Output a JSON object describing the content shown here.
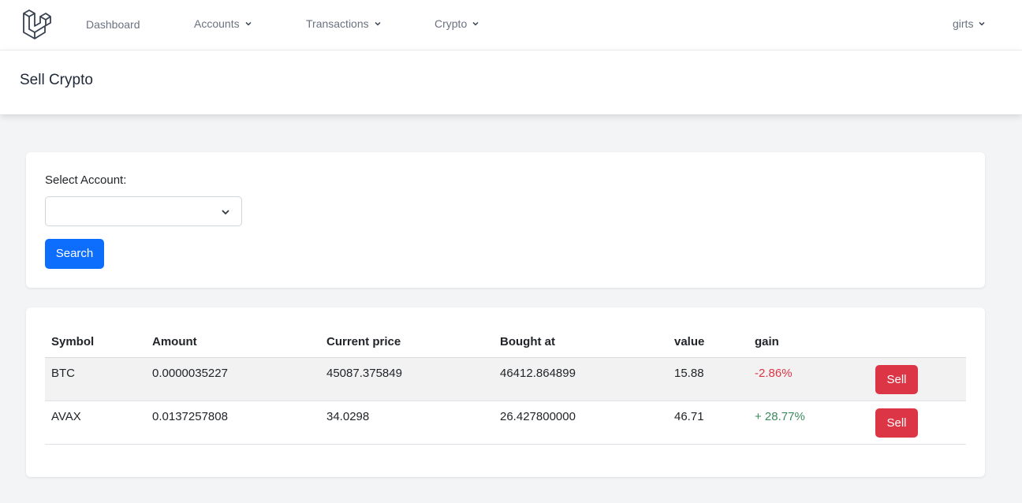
{
  "nav": {
    "items": [
      {
        "label": "Dashboard",
        "has_dropdown": false
      },
      {
        "label": "Accounts",
        "has_dropdown": true
      },
      {
        "label": "Transactions",
        "has_dropdown": true
      },
      {
        "label": "Crypto",
        "has_dropdown": true
      }
    ],
    "user": {
      "label": "girts",
      "has_dropdown": true
    },
    "logo_icon": "laravel-logo-icon"
  },
  "header": {
    "title": "Sell Crypto"
  },
  "search_form": {
    "label": "Select Account:",
    "selected_value": "",
    "button_label": "Search"
  },
  "table": {
    "columns": [
      "Symbol",
      "Amount",
      "Current price",
      "Bought at",
      "value",
      "gain",
      ""
    ],
    "rows": [
      {
        "symbol": "BTC",
        "amount": "0.0000035227",
        "current_price": "45087.375849",
        "bought_at": "46412.864899",
        "value": "15.88",
        "gain": "-2.86%",
        "gain_trend": "negative",
        "action": "Sell"
      },
      {
        "symbol": "AVAX",
        "amount": "0.0137257808",
        "current_price": "34.0298",
        "bought_at": "26.427800000",
        "value": "46.71",
        "gain": "+ 28.77%",
        "gain_trend": "positive",
        "action": "Sell"
      }
    ]
  },
  "colors": {
    "primary": "#0d6efd",
    "danger": "#dc3545",
    "gain_positive": "#3c8a5f",
    "gain_negative": "#dc3545",
    "background": "#f3f4f6"
  }
}
